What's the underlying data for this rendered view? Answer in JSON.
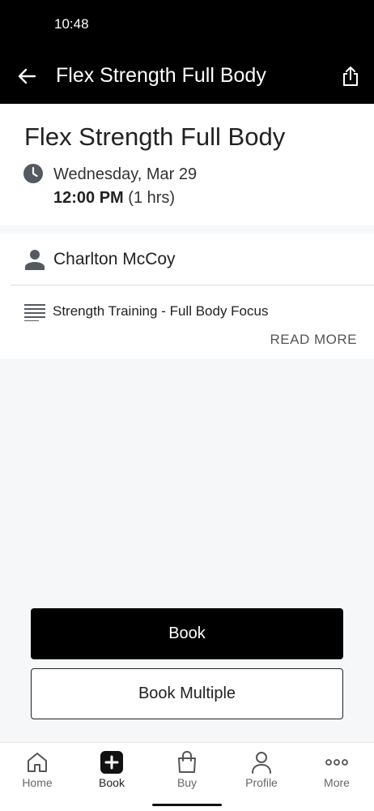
{
  "status_bar": {
    "time": "10:48"
  },
  "app_bar": {
    "title": "Flex Strength Full Body",
    "back_icon": "arrow-left-icon",
    "share_icon": "share-icon"
  },
  "class_info": {
    "title": "Flex Strength Full Body",
    "date": "Wednesday, Mar 29",
    "time": "12:00 PM",
    "duration": "(1 hrs)"
  },
  "details": {
    "instructor": "Charlton McCoy",
    "description": "Strength Training - Full Body Focus",
    "read_more": "READ MORE"
  },
  "actions": {
    "book_label": "Book",
    "book_multiple_label": "Book Multiple"
  },
  "bottom_nav": {
    "active": "Book",
    "items": [
      {
        "label": "Home",
        "icon": "home-icon"
      },
      {
        "label": "Book",
        "icon": "plus-square-icon"
      },
      {
        "label": "Buy",
        "icon": "shopping-bag-icon"
      },
      {
        "label": "Profile",
        "icon": "person-icon"
      },
      {
        "label": "More",
        "icon": "more-dots-icon"
      }
    ]
  },
  "colors": {
    "app_bar": "#000000",
    "primary_button": "#000000",
    "background": "#f6f7f9"
  }
}
